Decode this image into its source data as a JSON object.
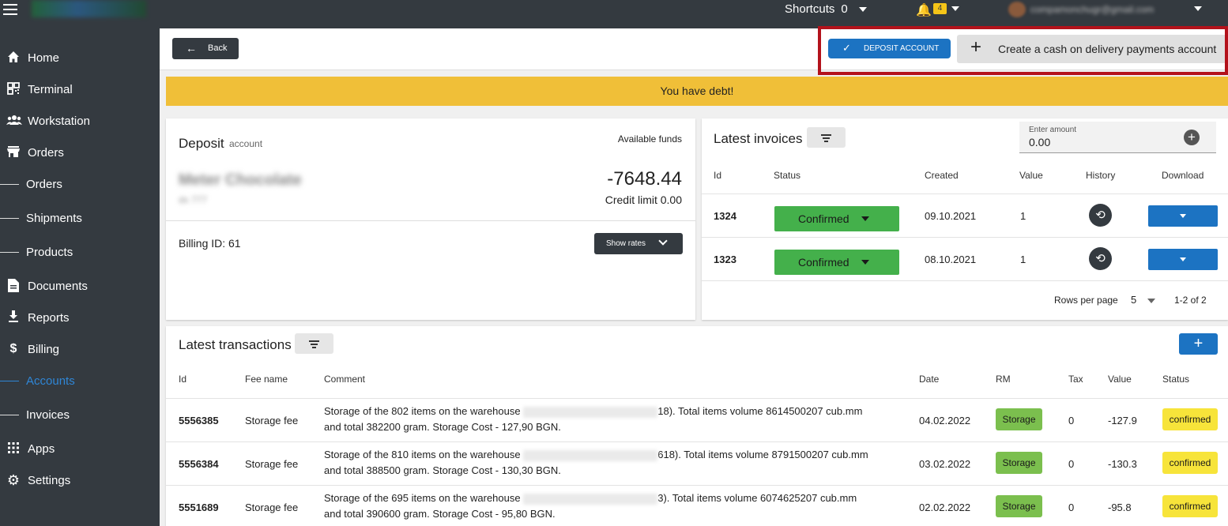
{
  "topbar": {
    "shortcuts_label": "Shortcuts",
    "shortcuts_count": "0",
    "notification_count": "4",
    "user_email": "compamonchugr@gmail.com"
  },
  "sidebar": {
    "items": [
      {
        "label": "Home",
        "icon": "home-icon"
      },
      {
        "label": "Terminal",
        "icon": "qr-code-icon"
      },
      {
        "label": "Workstation",
        "icon": "people-icon"
      },
      {
        "label": "Orders",
        "icon": "store-icon"
      },
      {
        "label": "Orders"
      },
      {
        "label": "Shipments"
      },
      {
        "label": "Products"
      },
      {
        "label": "Documents",
        "icon": "document-icon"
      },
      {
        "label": "Reports",
        "icon": "download-icon"
      },
      {
        "label": "Billing",
        "icon": "dollar-icon"
      },
      {
        "label": "Accounts",
        "active": true
      },
      {
        "label": "Invoices"
      },
      {
        "label": "Apps",
        "icon": "apps-grid-icon"
      },
      {
        "label": "Settings",
        "icon": "gear-icon"
      }
    ]
  },
  "header": {
    "back_label": "Back",
    "deposit_account_label": "DEPOSIT ACCOUNT",
    "cod_account_label": "Create a cash on delivery payments account"
  },
  "banner": {
    "text": "You have debt!"
  },
  "deposit": {
    "title": "Deposit",
    "subtitle": "account",
    "available_funds_label": "Available funds",
    "company_name": "Meter Chocolate",
    "company_sub": "ds 777",
    "balance": "-7648.44",
    "credit_limit": "Credit limit 0.00",
    "billing_id": "Billing ID: 61",
    "show_rates_label": "Show rates"
  },
  "invoices": {
    "title": "Latest invoices",
    "amount_placeholder": "Enter amount",
    "amount_value": "0.00",
    "columns": [
      "Id",
      "Status",
      "Created",
      "Value",
      "History",
      "Download"
    ],
    "rows": [
      {
        "id": "1324",
        "status": "Confirmed",
        "created": "09.10.2021",
        "value": "1"
      },
      {
        "id": "1323",
        "status": "Confirmed",
        "created": "08.10.2021",
        "value": "1"
      }
    ],
    "rows_per_page_label": "Rows per page",
    "rows_per_page": "5",
    "range": "1-2 of 2"
  },
  "transactions": {
    "title": "Latest transactions",
    "columns": [
      "Id",
      "Fee name",
      "Comment",
      "Date",
      "RM",
      "Tax",
      "Value",
      "Status"
    ],
    "rows": [
      {
        "id": "5556385",
        "fee": "Storage fee",
        "comment_a": "Storage of the 802 items on the warehouse",
        "comment_b": "18). Total items volume 8614500207 cub.mm",
        "comment_c": "and total 382200 gram. Storage Cost - 127,90 BGN.",
        "date": "04.02.2022",
        "rm": "Storage",
        "tax": "0",
        "value": "-127.9",
        "status": "confirmed"
      },
      {
        "id": "5556384",
        "fee": "Storage fee",
        "comment_a": "Storage of the 810 items on the warehouse",
        "comment_b": "618). Total items volume 8791500207 cub.mm",
        "comment_c": "and total 388500 gram. Storage Cost - 130,30 BGN.",
        "date": "03.02.2022",
        "rm": "Storage",
        "tax": "0",
        "value": "-130.3",
        "status": "confirmed"
      },
      {
        "id": "5551689",
        "fee": "Storage fee",
        "comment_a": "Storage of the 695 items on the warehouse",
        "comment_b": "3). Total items volume 6074625207 cub.mm",
        "comment_c": "and total 390600 gram. Storage Cost - 95,80 BGN.",
        "date": "02.02.2022",
        "rm": "Storage",
        "tax": "0",
        "value": "-95.8",
        "status": "confirmed"
      }
    ]
  },
  "colors": {
    "sidebar": "#343a40",
    "accent": "#1c73c2",
    "debt_banner": "#f0bf38",
    "confirmed": "#44b04b",
    "highlight": "#b3121b"
  }
}
